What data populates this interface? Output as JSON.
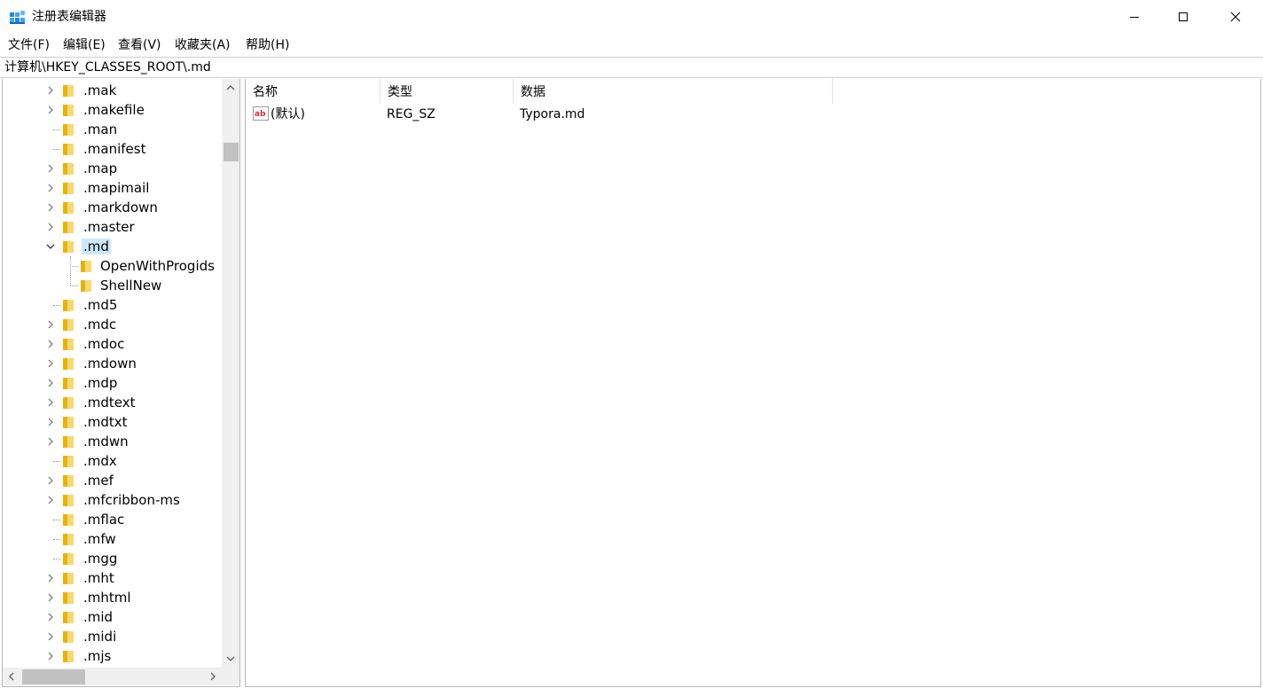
{
  "window": {
    "title": "注册表编辑器",
    "controls": [
      "minimize",
      "maximize",
      "close"
    ]
  },
  "menu": {
    "items": [
      {
        "label": "文件(F)"
      },
      {
        "label": "编辑(E)"
      },
      {
        "label": "查看(V)"
      },
      {
        "label": "收藏夹(A)"
      },
      {
        "label": "帮助(H)"
      }
    ]
  },
  "address": {
    "path": "计算机\\HKEY_CLASSES_ROOT\\.md"
  },
  "tree": {
    "items": [
      {
        "label": ".mak",
        "expandable": true
      },
      {
        "label": ".makefile",
        "expandable": true
      },
      {
        "label": ".man",
        "expandable": false
      },
      {
        "label": ".manifest",
        "expandable": false
      },
      {
        "label": ".map",
        "expandable": true
      },
      {
        "label": ".mapimail",
        "expandable": true
      },
      {
        "label": ".markdown",
        "expandable": true
      },
      {
        "label": ".master",
        "expandable": true
      },
      {
        "label": ".md",
        "expandable": true,
        "expanded": true,
        "selected": true
      },
      {
        "label": "OpenWithProgids",
        "child": true
      },
      {
        "label": "ShellNew",
        "child": true
      },
      {
        "label": ".md5",
        "expandable": false
      },
      {
        "label": ".mdc",
        "expandable": true
      },
      {
        "label": ".mdoc",
        "expandable": true
      },
      {
        "label": ".mdown",
        "expandable": true
      },
      {
        "label": ".mdp",
        "expandable": true
      },
      {
        "label": ".mdtext",
        "expandable": true
      },
      {
        "label": ".mdtxt",
        "expandable": true
      },
      {
        "label": ".mdwn",
        "expandable": true
      },
      {
        "label": ".mdx",
        "expandable": false
      },
      {
        "label": ".mef",
        "expandable": true
      },
      {
        "label": ".mfcribbon-ms",
        "expandable": true
      },
      {
        "label": ".mflac",
        "expandable": false
      },
      {
        "label": ".mfw",
        "expandable": false
      },
      {
        "label": ".mgg",
        "expandable": false
      },
      {
        "label": ".mht",
        "expandable": true
      },
      {
        "label": ".mhtml",
        "expandable": true
      },
      {
        "label": ".mid",
        "expandable": true
      },
      {
        "label": ".midi",
        "expandable": true
      },
      {
        "label": ".mjs",
        "expandable": true
      }
    ]
  },
  "values": {
    "headers": {
      "name": "名称",
      "type": "类型",
      "data": "数据"
    },
    "rows": [
      {
        "name": "(默认)",
        "type": "REG_SZ",
        "data": "Typora.md",
        "icon": "string-value-icon"
      }
    ]
  },
  "colors": {
    "selection": "#cce8ff",
    "folder": "#f2c94c",
    "scrollbar_track": "#f0f0f0",
    "scrollbar_thumb": "#c1c1c1"
  }
}
